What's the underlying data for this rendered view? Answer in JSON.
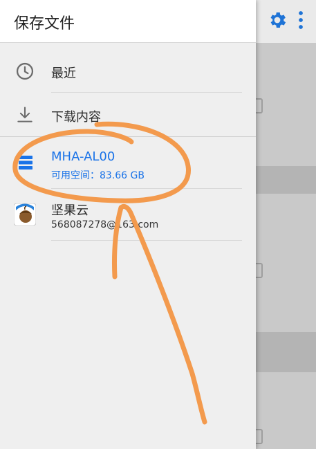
{
  "drawer": {
    "title": "保存文件",
    "items": [
      {
        "label": "最近",
        "icon": "clock-icon"
      },
      {
        "label": "下载内容",
        "icon": "download-icon"
      },
      {
        "label": "MHA-AL00",
        "sub": "可用空间：83.66 GB",
        "icon": "storage-icon",
        "selected": true
      },
      {
        "label": "坚果云",
        "sub": "568087278@163.com",
        "icon": "jianguoyun-app-icon"
      }
    ]
  },
  "toolbar": {
    "settings_icon": "gear-icon",
    "more_icon": "more-vert-icon"
  },
  "colors": {
    "accent": "#1a73e8",
    "annotation": "#f39a4d",
    "drawer_bg": "#efefef"
  }
}
